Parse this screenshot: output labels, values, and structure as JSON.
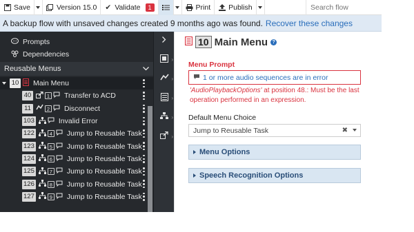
{
  "toolbar": {
    "save": "Save",
    "version": "Version 15.0",
    "validate": "Validate",
    "validate_count": "1",
    "print": "Print",
    "publish": "Publish",
    "search_placeholder": "Search flow"
  },
  "banner": {
    "message": "A backup flow with unsaved changes created 9 months ago was found.",
    "link": "Recover these changes"
  },
  "left": {
    "prompts": "Prompts",
    "dependencies": "Dependencies",
    "section_title": "Reusable Menus",
    "main_menu": {
      "num": "10",
      "label": "Main Menu"
    },
    "items": [
      {
        "num": "40",
        "key": "1",
        "label": "Transfer to ACD",
        "icon": "transfer-icon"
      },
      {
        "num": "11",
        "key": "2",
        "label": "Disconnect",
        "icon": "disconnect-icon"
      },
      {
        "num": "103",
        "key": "",
        "label": "Invalid Error",
        "icon": "flow-icon"
      },
      {
        "num": "122",
        "key": "4",
        "label": "Jump to Reusable Task",
        "icon": "flow-icon"
      },
      {
        "num": "123",
        "key": "5",
        "label": "Jump to Reusable Task",
        "icon": "flow-icon"
      },
      {
        "num": "124",
        "key": "6",
        "label": "Jump to Reusable Task",
        "icon": "flow-icon"
      },
      {
        "num": "125",
        "key": "7",
        "label": "Jump to Reusable Task",
        "icon": "flow-icon"
      },
      {
        "num": "126",
        "key": "8",
        "label": "Jump to Reusable Task",
        "icon": "flow-icon"
      },
      {
        "num": "127",
        "key": "9",
        "label": "Jump to Reusable Task",
        "icon": "flow-icon"
      }
    ]
  },
  "main": {
    "title_num": "10",
    "title": "Main Menu",
    "menu_prompt_label": "Menu Prompt",
    "menu_prompt_value": "1 or more audio sequences are in error",
    "error_var": "'AudioPlaybackOptions'",
    "error_text": " at position 48.: Must be the last operation performed in an expression.",
    "default_choice_label": "Default Menu Choice",
    "default_choice_value": "Jump to Reusable Task",
    "menu_options": "Menu Options",
    "speech_options": "Speech Recognition Options"
  },
  "colors": {
    "accent": "#2a6ebb",
    "error": "#d9333f",
    "dark_panel": "#26292d"
  }
}
